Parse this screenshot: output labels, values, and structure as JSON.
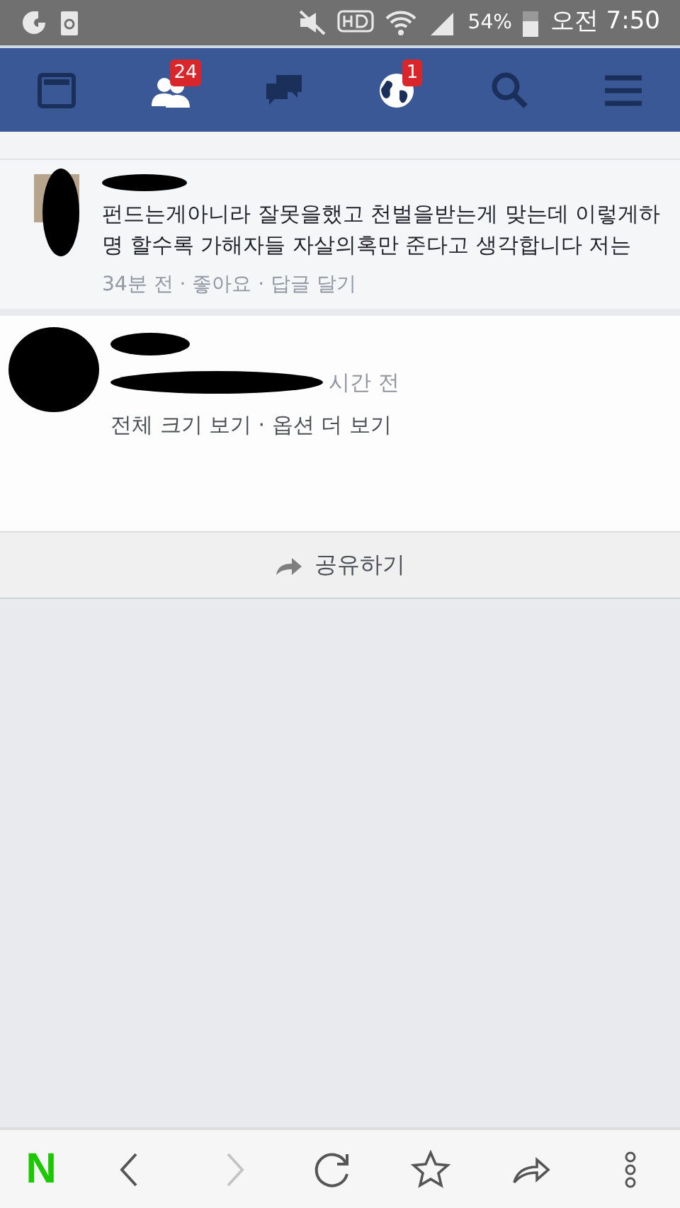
{
  "status_bar": {
    "battery": "54%",
    "time": "오전 7:50"
  },
  "nav_tabs": [
    {
      "kind": "news"
    },
    {
      "kind": "friends",
      "badge": "24"
    },
    {
      "kind": "messages"
    },
    {
      "kind": "globe",
      "badge": "1"
    },
    {
      "kind": "search"
    },
    {
      "kind": "menu"
    }
  ],
  "comment": {
    "text": "펀드는게아니라 잘못을했고 천벌을받는게 맞는데 이렇게하명 할수록 가해자들 자살의혹만 준다고 생각합니다 저는",
    "meta": "34분 전 · 좋아요 · 답글 달기"
  },
  "photo_post": {
    "meta": "시간 전",
    "links": "전체 크기 보기 · 옵션 더 보기"
  },
  "share_button": {
    "label": "공유하기"
  },
  "browser_toolbar": {
    "logo": "N",
    "buttons": [
      {
        "kind": "back",
        "disabled": false
      },
      {
        "kind": "forward",
        "disabled": true
      },
      {
        "kind": "reload",
        "disabled": false
      },
      {
        "kind": "star",
        "disabled": false
      },
      {
        "kind": "share",
        "disabled": false
      },
      {
        "kind": "more",
        "disabled": false
      }
    ]
  }
}
